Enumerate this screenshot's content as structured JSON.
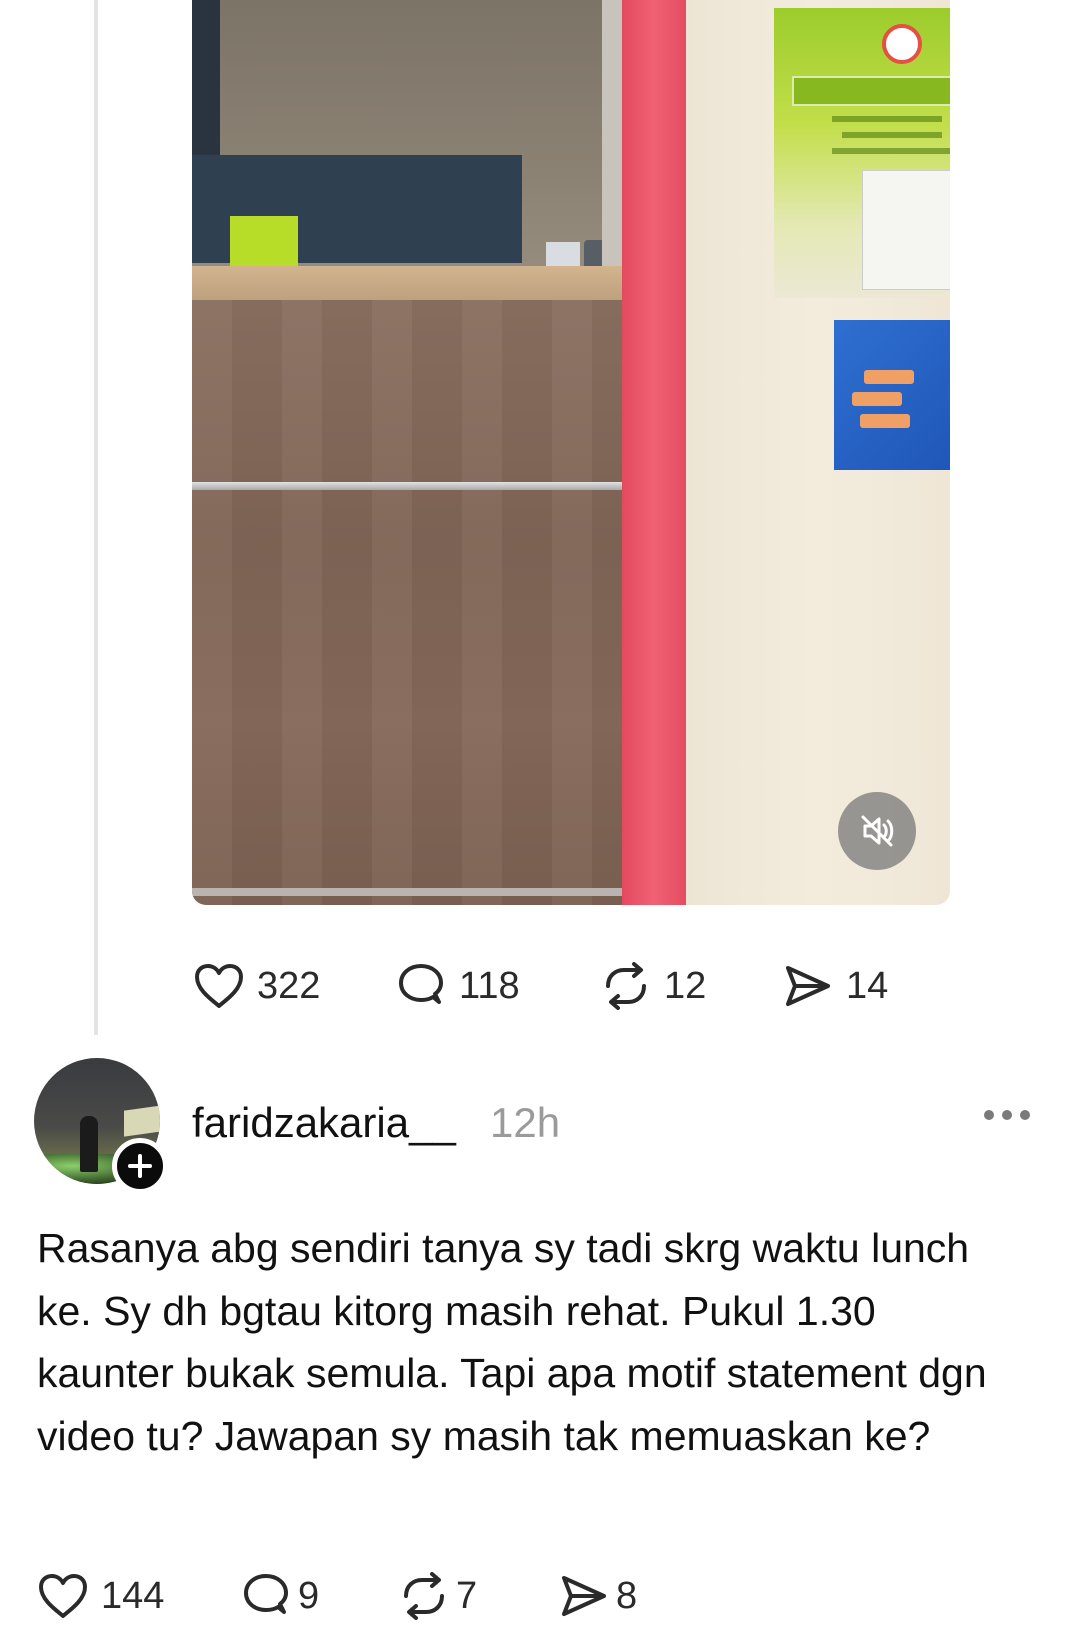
{
  "post": {
    "stats": {
      "likes": "322",
      "replies": "118",
      "reposts": "12",
      "shares": "14"
    },
    "video": {
      "mute_icon": "speaker-muted-icon"
    }
  },
  "reply": {
    "username": "faridzakaria__",
    "time": "12h",
    "text": "Rasanya abg sendiri tanya sy tadi skrg waktu lunch ke. Sy dh bgtau kitorg masih rehat. Pukul 1.30 kaunter bukak semula. Tapi apa motif statement dgn video tu? Jawapan sy masih tak memuaskan ke?",
    "stats": {
      "likes": "144",
      "replies": "9",
      "reposts": "7",
      "shares": "8"
    }
  },
  "icons": {
    "like": "heart-icon",
    "reply": "speech-bubble-icon",
    "repost": "repost-icon",
    "share": "send-icon",
    "follow": "plus-icon",
    "more": "more-dots-icon"
  },
  "colors": {
    "text": "#111111",
    "muted": "#9a9a9a",
    "thread_line": "#e4e4e4"
  }
}
